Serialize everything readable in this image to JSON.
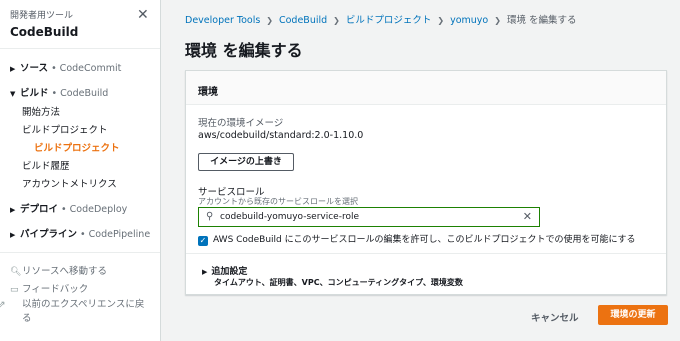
{
  "sidebar": {
    "subtitle": "開発者用ツール",
    "title": "CodeBuild",
    "groups": [
      {
        "label": "ソース",
        "service": "• CodeCommit"
      },
      {
        "label": "ビルド",
        "service": "• CodeBuild"
      },
      {
        "label": "デプロイ",
        "service": "• CodeDeploy"
      },
      {
        "label": "パイプライン",
        "service": "• CodePipeline"
      }
    ],
    "build_items": [
      "開始方法",
      "ビルドプロジェクト",
      "ビルドプロジェクト",
      "ビルド履歴",
      "アカウントメトリクス"
    ],
    "footer": [
      "リソースへ移動する",
      "フィードバック",
      "以前のエクスペリエンスに戻る"
    ]
  },
  "breadcrumb": [
    "Developer Tools",
    "CodeBuild",
    "ビルドプロジェクト",
    "yomuyo",
    "環境 を編集する"
  ],
  "page_title": "環境 を編集する",
  "panel": {
    "header": "環境",
    "current_image_label": "現在の環境イメージ",
    "current_image_value": "aws/codebuild/standard:2.0-1.10.0",
    "override_button": "イメージの上書き",
    "service_role_label": "サービスロール",
    "service_role_hint": "アカウントから既存のサービスロールを選択",
    "service_role_value": "codebuild-yomuyo-service-role",
    "checkbox_label": "AWS CodeBuild にこのサービスロールの編集を許可し、このビルドプロジェクトでの使用を可能にする",
    "advanced_title": "追加設定",
    "advanced_desc": "タイムアウト、証明書、VPC、コンピューティングタイプ、環境変数"
  },
  "actions": {
    "cancel": "キャンセル",
    "update": "環境の更新"
  },
  "colors": {
    "accent": "#ec7211",
    "link": "#0073bb",
    "valid_border": "#1d8102"
  }
}
